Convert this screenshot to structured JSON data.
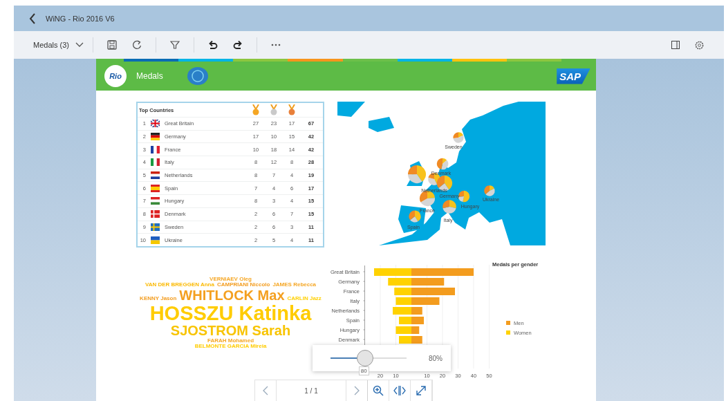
{
  "window": {
    "title": "WiNG - Rio 2016 V6"
  },
  "toolbar": {
    "story_menu": "Medals (3)"
  },
  "page_header": {
    "logo_text": "Rio",
    "title": "Medals",
    "brand": "SAP"
  },
  "table": {
    "title": "Top Countries",
    "rows": [
      {
        "rank": "1",
        "country": "Great Britain",
        "gold": "27",
        "silver": "23",
        "bronze": "17",
        "total": "67"
      },
      {
        "rank": "2",
        "country": "Germany",
        "gold": "17",
        "silver": "10",
        "bronze": "15",
        "total": "42"
      },
      {
        "rank": "3",
        "country": "France",
        "gold": "10",
        "silver": "18",
        "bronze": "14",
        "total": "42"
      },
      {
        "rank": "4",
        "country": "Italy",
        "gold": "8",
        "silver": "12",
        "bronze": "8",
        "total": "28"
      },
      {
        "rank": "5",
        "country": "Netherlands",
        "gold": "8",
        "silver": "7",
        "bronze": "4",
        "total": "19"
      },
      {
        "rank": "6",
        "country": "Spain",
        "gold": "7",
        "silver": "4",
        "bronze": "6",
        "total": "17"
      },
      {
        "rank": "7",
        "country": "Hungary",
        "gold": "8",
        "silver": "3",
        "bronze": "4",
        "total": "15"
      },
      {
        "rank": "8",
        "country": "Denmark",
        "gold": "2",
        "silver": "6",
        "bronze": "7",
        "total": "15"
      },
      {
        "rank": "9",
        "country": "Sweden",
        "gold": "2",
        "silver": "6",
        "bronze": "3",
        "total": "11"
      },
      {
        "rank": "10",
        "country": "Ukraine",
        "gold": "2",
        "silver": "5",
        "bronze": "4",
        "total": "11"
      }
    ]
  },
  "map": {
    "labels": [
      "Sweden",
      "Denmark",
      "Netherlands",
      "Germany",
      "France",
      "Hungary",
      "Ukraine",
      "Italy",
      "Spain"
    ]
  },
  "word_cloud": {
    "lines": [
      [
        {
          "text": "VERNIAEV Oleg",
          "color": "#f5a623"
        }
      ],
      [
        {
          "text": "VAN DER BREGGEN Anna",
          "color": "#fbb900"
        },
        {
          "text": "CAMPRIANI Niccolo",
          "color": "#f39c1e"
        },
        {
          "text": "JAMES Rebecca",
          "color": "#f5a623"
        }
      ],
      [
        {
          "text": "KENNY Jason",
          "color": "#f39c1e"
        },
        {
          "text": "WHITLOCK Max",
          "color": "#f4a020"
        },
        {
          "text": "CARLIN Jazz",
          "color": "#ffd000"
        }
      ],
      [
        {
          "text": "HOSSZU Katinka",
          "color": "#ffcc00"
        }
      ],
      [
        {
          "text": "SJOSTROM Sarah",
          "color": "#f8c400"
        }
      ],
      [
        {
          "text": "FARAH Mohamed",
          "color": "#f5a623"
        }
      ],
      [
        {
          "text": "BELMONTE GARCIA Mireia",
          "color": "#ffcc00"
        }
      ]
    ]
  },
  "gender_chart": {
    "chart_data": {
      "type": "bar",
      "orientation": "horizontal",
      "stacked": true,
      "title": "Medals per gender",
      "grid": true,
      "categories": [
        "Great Britain",
        "Germany",
        "France",
        "Italy",
        "Netherlands",
        "Spain",
        "Hungary",
        "Denmark"
      ],
      "series": [
        {
          "name": "Men",
          "color": "#f39c1e",
          "values": [
            40,
            21,
            28,
            18,
            7,
            8,
            5,
            7
          ]
        },
        {
          "name": "Women",
          "color": "#ffd200",
          "values": [
            -24,
            -15,
            -11,
            -10,
            -12,
            -8,
            -10,
            -8
          ]
        }
      ],
      "xlim": [
        -30,
        50
      ],
      "xticks": [
        {
          "value": -20,
          "label": "20"
        },
        {
          "value": -10,
          "label": "10"
        },
        10,
        20,
        30,
        40,
        50
      ]
    }
  },
  "pager": {
    "page": "1 / 1"
  },
  "zoom_popover": {
    "level": 0.37,
    "reading": "80%",
    "tooltip": "80"
  }
}
